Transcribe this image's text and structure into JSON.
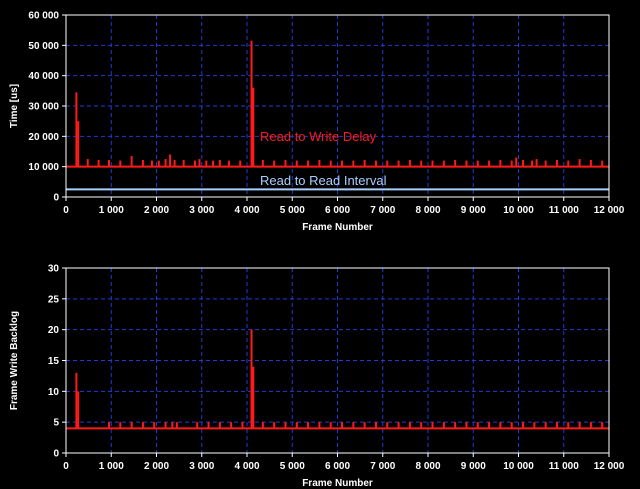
{
  "chart_data": [
    {
      "type": "line",
      "xlabel": "Frame Number",
      "ylabel": "Time [us]",
      "xlim": [
        0,
        12000
      ],
      "ylim": [
        0,
        60000
      ],
      "xticks": [
        0,
        1000,
        2000,
        3000,
        4000,
        5000,
        6000,
        7000,
        8000,
        9000,
        10000,
        11000,
        12000
      ],
      "xtick_labels": [
        "0",
        "1 000",
        "2 000",
        "3 000",
        "4 000",
        "5 000",
        "6 000",
        "7 000",
        "8 000",
        "9 000",
        "10 000",
        "11 000",
        "12 000"
      ],
      "yticks": [
        0,
        10000,
        20000,
        30000,
        40000,
        50000,
        60000
      ],
      "ytick_labels": [
        "0",
        "10 000",
        "20 000",
        "30 000",
        "40 000",
        "50 000",
        "60 000"
      ],
      "grid": true,
      "series": [
        {
          "name": "Read to Write Delay",
          "color": "#ff1a1a",
          "baseline": 10000,
          "spikes": [
            [
              230,
              34500
            ],
            [
              270,
              25000
            ],
            [
              480,
              12500
            ],
            [
              720,
              12200
            ],
            [
              950,
              12200
            ],
            [
              1200,
              12000
            ],
            [
              1450,
              13500
            ],
            [
              1700,
              12200
            ],
            [
              1900,
              12000
            ],
            [
              2050,
              12000
            ],
            [
              2200,
              12500
            ],
            [
              2300,
              14000
            ],
            [
              2400,
              12200
            ],
            [
              2600,
              12200
            ],
            [
              2850,
              12000
            ],
            [
              2950,
              12500
            ],
            [
              3100,
              12000
            ],
            [
              3250,
              12000
            ],
            [
              3400,
              12200
            ],
            [
              3600,
              12000
            ],
            [
              3850,
              12000
            ],
            [
              4100,
              51500
            ],
            [
              4140,
              36000
            ],
            [
              4350,
              12200
            ],
            [
              4600,
              12000
            ],
            [
              4850,
              12200
            ],
            [
              5100,
              12000
            ],
            [
              5350,
              12000
            ],
            [
              5600,
              12200
            ],
            [
              5850,
              12000
            ],
            [
              6100,
              12000
            ],
            [
              6350,
              12000
            ],
            [
              6600,
              12200
            ],
            [
              6850,
              12000
            ],
            [
              7100,
              12000
            ],
            [
              7350,
              12000
            ],
            [
              7600,
              12200
            ],
            [
              7850,
              12000
            ],
            [
              8100,
              12000
            ],
            [
              8350,
              12000
            ],
            [
              8600,
              12200
            ],
            [
              8850,
              12000
            ],
            [
              9100,
              12000
            ],
            [
              9350,
              12000
            ],
            [
              9600,
              12200
            ],
            [
              9850,
              12000
            ],
            [
              9950,
              13000
            ],
            [
              10100,
              12200
            ],
            [
              10300,
              12000
            ],
            [
              10400,
              12500
            ],
            [
              10600,
              12000
            ],
            [
              10850,
              12200
            ],
            [
              11100,
              12000
            ],
            [
              11350,
              12500
            ],
            [
              11600,
              12200
            ],
            [
              11850,
              12000
            ]
          ]
        },
        {
          "name": "Read to Read Interval",
          "color": "#a8d0ff",
          "constant": 2500
        }
      ]
    },
    {
      "type": "line",
      "xlabel": "Frame Number",
      "ylabel": "Frame Write Backlog",
      "xlim": [
        0,
        12000
      ],
      "ylim": [
        0,
        30
      ],
      "xticks": [
        0,
        1000,
        2000,
        3000,
        4000,
        5000,
        6000,
        7000,
        8000,
        9000,
        10000,
        11000,
        12000
      ],
      "xtick_labels": [
        "0",
        "1 000",
        "2 000",
        "3 000",
        "4 000",
        "5 000",
        "6 000",
        "7 000",
        "8 000",
        "9 000",
        "10 000",
        "11 000",
        "12 000"
      ],
      "yticks": [
        0,
        5,
        10,
        15,
        20,
        25,
        30
      ],
      "ytick_labels": [
        "0",
        "5",
        "10",
        "15",
        "20",
        "25",
        "30"
      ],
      "grid": true,
      "series": [
        {
          "color": "#ff1a1a",
          "baseline": 4,
          "spikes": [
            [
              230,
              13
            ],
            [
              270,
              10
            ],
            [
              950,
              5
            ],
            [
              1200,
              5
            ],
            [
              1450,
              5
            ],
            [
              1700,
              5
            ],
            [
              1950,
              5
            ],
            [
              2200,
              5
            ],
            [
              2350,
              5
            ],
            [
              2450,
              5
            ],
            [
              2900,
              5
            ],
            [
              3150,
              5
            ],
            [
              3400,
              5
            ],
            [
              3650,
              5
            ],
            [
              3900,
              5
            ],
            [
              4100,
              20
            ],
            [
              4140,
              14
            ],
            [
              4350,
              5
            ],
            [
              4600,
              5
            ],
            [
              4850,
              5
            ],
            [
              5100,
              5
            ],
            [
              5350,
              5
            ],
            [
              5600,
              5
            ],
            [
              5850,
              5
            ],
            [
              6100,
              5
            ],
            [
              6350,
              5
            ],
            [
              6600,
              5
            ],
            [
              6850,
              5
            ],
            [
              7100,
              5
            ],
            [
              7350,
              5
            ],
            [
              7600,
              5
            ],
            [
              7850,
              5
            ],
            [
              8100,
              5
            ],
            [
              8350,
              5
            ],
            [
              8600,
              5
            ],
            [
              8850,
              5
            ],
            [
              9100,
              5
            ],
            [
              9350,
              5
            ],
            [
              9600,
              5
            ],
            [
              9850,
              5
            ],
            [
              10100,
              5
            ],
            [
              10350,
              5
            ],
            [
              10600,
              5
            ],
            [
              10850,
              5
            ],
            [
              11100,
              5
            ],
            [
              11350,
              5
            ],
            [
              11600,
              5
            ],
            [
              11850,
              5
            ]
          ]
        }
      ]
    }
  ]
}
